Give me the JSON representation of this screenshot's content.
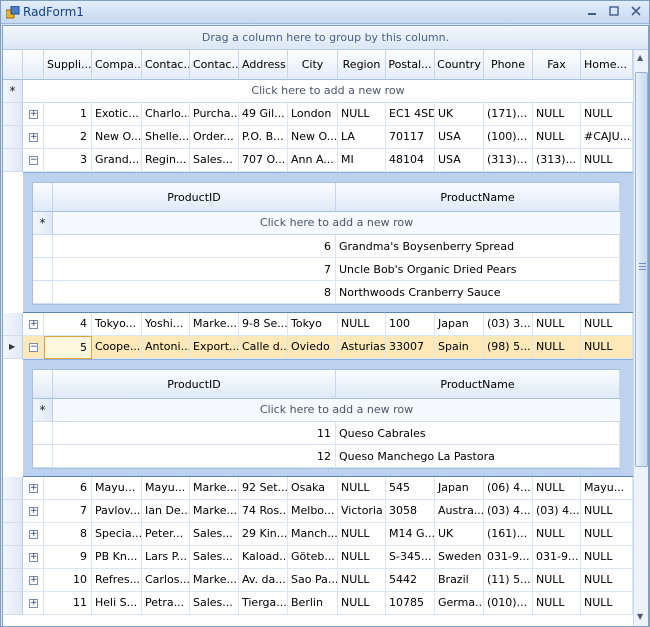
{
  "window": {
    "title": "RadForm1"
  },
  "group_panel": {
    "text": "Drag a column here to group by this column."
  },
  "new_row_text": "Click here to add a new row",
  "columns": [
    "Suppli...",
    "Compa...",
    "Contac...",
    "Contac...",
    "Address",
    "City",
    "Region",
    "Postal...",
    "Country",
    "Phone",
    "Fax",
    "Home..."
  ],
  "rows": [
    {
      "id": "1",
      "cells": [
        "Exotic...",
        "Charlo...",
        "Purcha...",
        "49 Gil...",
        "London",
        "NULL",
        "EC1 4SD",
        "UK",
        "(171)...",
        "NULL",
        "NULL"
      ],
      "expanded": false
    },
    {
      "id": "2",
      "cells": [
        "New O...",
        "Shelle...",
        "Order...",
        "P.O. B...",
        "New O...",
        "LA",
        "70117",
        "USA",
        "(100)...",
        "NULL",
        "#CAJU..."
      ],
      "expanded": false
    },
    {
      "id": "3",
      "cells": [
        "Grand...",
        "Regin...",
        "Sales...",
        "707 O...",
        "Ann A...",
        "MI",
        "48104",
        "USA",
        "(313)...",
        "(313)...",
        "NULL"
      ],
      "expanded": true
    },
    {
      "id": "4",
      "cells": [
        "Tokyo...",
        "Yoshi...",
        "Marke...",
        "9-8 Se...",
        "Tokyo",
        "NULL",
        "100",
        "Japan",
        "(03) 3...",
        "NULL",
        "NULL"
      ],
      "expanded": false
    },
    {
      "id": "5",
      "cells": [
        "Coope...",
        "Antoni...",
        "Export...",
        "Calle d...",
        "Oviedo",
        "Asturias",
        "33007",
        "Spain",
        "(98) 5...",
        "NULL",
        "NULL"
      ],
      "expanded": true,
      "selected": true
    },
    {
      "id": "6",
      "cells": [
        "Mayu...",
        "Mayu...",
        "Marke...",
        "92 Set...",
        "Osaka",
        "NULL",
        "545",
        "Japan",
        "(06) 4...",
        "NULL",
        "Mayu..."
      ],
      "expanded": false
    },
    {
      "id": "7",
      "cells": [
        "Pavlov...",
        "Ian De...",
        "Marke...",
        "74 Ros...",
        "Melbo...",
        "Victoria",
        "3058",
        "Austra...",
        "(03) 4...",
        "(03) 4...",
        "NULL"
      ],
      "expanded": false
    },
    {
      "id": "8",
      "cells": [
        "Specia...",
        "Peter...",
        "Sales...",
        "29 Kin...",
        "Manch...",
        "NULL",
        "M14 G...",
        "UK",
        "(161)...",
        "NULL",
        "NULL"
      ],
      "expanded": false
    },
    {
      "id": "9",
      "cells": [
        "PB Kn...",
        "Lars P...",
        "Sales...",
        "Kaload...",
        "Göteb...",
        "NULL",
        "S-345...",
        "Sweden",
        "031-9...",
        "031-9...",
        "NULL"
      ],
      "expanded": false
    },
    {
      "id": "10",
      "cells": [
        "Refres...",
        "Carlos...",
        "Marke...",
        "Av. da...",
        "Sao Pa...",
        "NULL",
        "5442",
        "Brazil",
        "(11) 5...",
        "NULL",
        "NULL"
      ],
      "expanded": false
    },
    {
      "id": "11",
      "cells": [
        "Heli S...",
        "Petra...",
        "Sales...",
        "Tierga...",
        "Berlin",
        "NULL",
        "10785",
        "Germa...",
        "(010)...",
        "NULL",
        "NULL"
      ],
      "expanded": false
    }
  ],
  "detail_columns": [
    "ProductID",
    "ProductName"
  ],
  "details": {
    "3": [
      [
        "6",
        "Grandma's Boysenberry Spread"
      ],
      [
        "7",
        "Uncle Bob's Organic Dried Pears"
      ],
      [
        "8",
        "Northwoods Cranberry Sauce"
      ]
    ],
    "5": [
      [
        "11",
        "Queso Cabrales"
      ],
      [
        "12",
        "Queso Manchego La Pastora"
      ]
    ]
  },
  "icons": {
    "expand": "plus-box-icon",
    "collapse": "minus-box-icon",
    "new_row": "asterisk-icon",
    "current_row": "row-pointer-icon"
  },
  "colors": {
    "selected_row": "#fde8b8",
    "accent": "#15428b"
  }
}
